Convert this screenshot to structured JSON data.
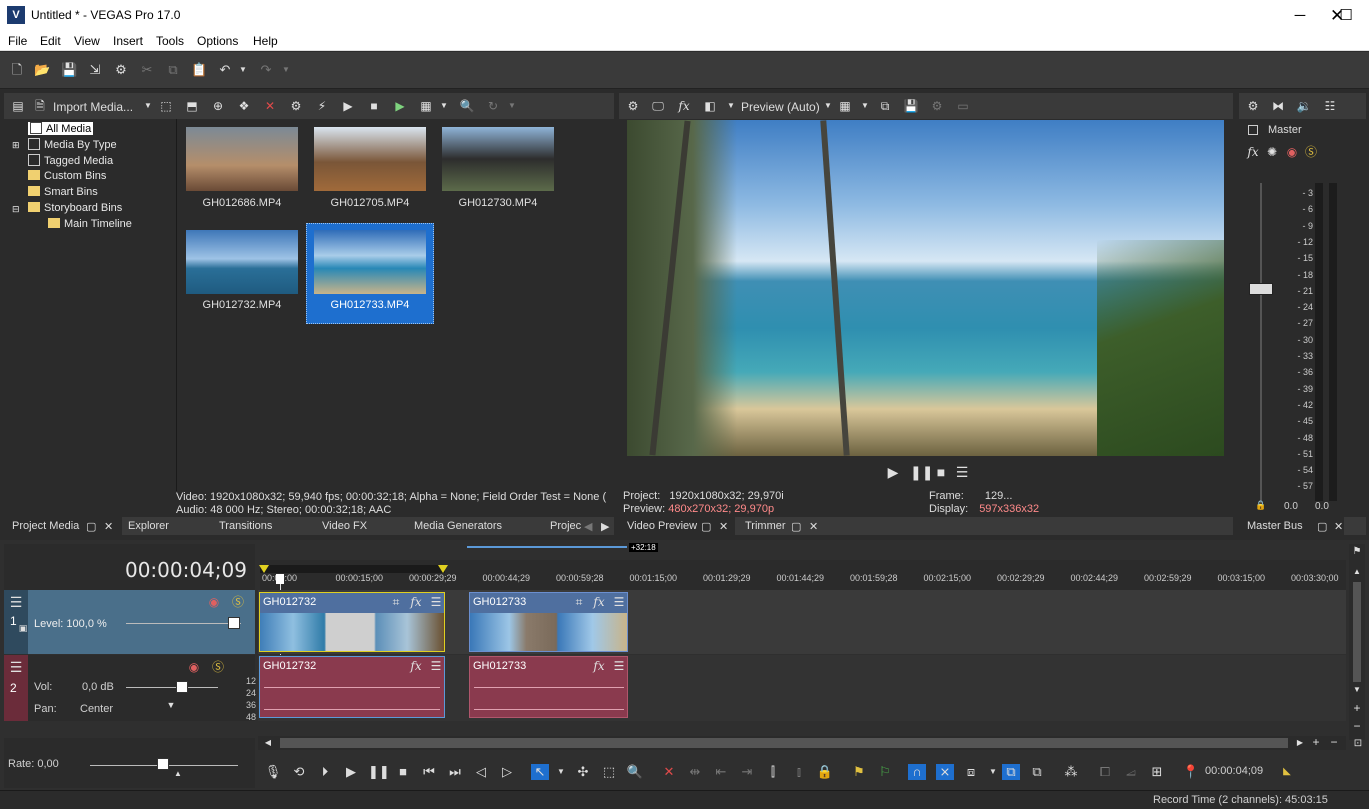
{
  "window": {
    "title": "Untitled * - VEGAS Pro 17.0",
    "logo": "V"
  },
  "menu": [
    "File",
    "Edit",
    "View",
    "Insert",
    "Tools",
    "Options",
    "Help"
  ],
  "media_panel": {
    "import_label": "Import Media...",
    "tree": [
      "All Media",
      "Media By Type",
      "Tagged Media",
      "Custom Bins",
      "Smart Bins",
      "Storyboard Bins",
      "Main Timeline"
    ],
    "items": [
      {
        "name": "GH012686.MP4"
      },
      {
        "name": "GH012705.MP4"
      },
      {
        "name": "GH012730.MP4"
      },
      {
        "name": "GH012732.MP4"
      },
      {
        "name": "GH012733.MP4",
        "selected": true
      }
    ],
    "info_video": "Video: 1920x1080x32; 59,940 fps; 00:00:32;18; Alpha = None; Field Order Test = None (",
    "info_audio": "Audio: 48 000 Hz; Stereo; 00:00:32;18; AAC",
    "tabs": [
      "Project Media",
      "Explorer",
      "Transitions",
      "Video FX",
      "Media Generators",
      "Projec"
    ]
  },
  "preview": {
    "quality": "Preview (Auto)",
    "project_label": "Project:",
    "project_value": "1920x1080x32; 29,970i",
    "preview_label": "Preview:",
    "preview_value": "480x270x32; 29,970p",
    "frame_label": "Frame:",
    "frame_value": "129...",
    "display_label": "Display:",
    "display_value": "597x336x32",
    "tabs": [
      "Video Preview",
      "Trimmer"
    ]
  },
  "master": {
    "label": "Master",
    "ticks": [
      "3",
      "6",
      "9",
      "12",
      "15",
      "18",
      "21",
      "24",
      "27",
      "30",
      "33",
      "36",
      "39",
      "42",
      "45",
      "48",
      "51",
      "54",
      "57"
    ],
    "left_value": "0.0",
    "right_value": "0.0",
    "tab": "Master Bus"
  },
  "timeline": {
    "timecode": "00:00:04;09",
    "loop_length": "+32:18",
    "ruler": [
      "00:00:00",
      "00:00:15;00",
      "00:00:29;29",
      "00:00:44;29",
      "00:00:59;28",
      "00:01:15;00",
      "00:01:29;29",
      "00:01:44;29",
      "00:01:59;28",
      "00:02:15;00",
      "00:02:29;29",
      "00:02:44;29",
      "00:02:59;29",
      "00:03:15;00",
      "00:03:30;00"
    ],
    "video_track": {
      "number": "1",
      "level": "Level: 100,0 %"
    },
    "audio_track": {
      "number": "2",
      "vol_label": "Vol:",
      "vol_value": "0,0 dB",
      "pan_label": "Pan:",
      "pan_value": "Center",
      "scale": [
        "12",
        "24",
        "36",
        "48"
      ]
    },
    "clips": [
      "GH012732",
      "GH012733"
    ],
    "rate": "Rate: 0,00",
    "cursor_time": "00:00:04;09"
  },
  "status": {
    "record_time": "Record Time (2 channels): 45:03:15"
  },
  "colors": {
    "accent": "#1e6fcf",
    "selected_thumb": "#1e6fcf",
    "preview_highlight": "#ff8a8a",
    "video_clip": "#4f6f9f",
    "audio_clip": "#8a3a4e"
  }
}
